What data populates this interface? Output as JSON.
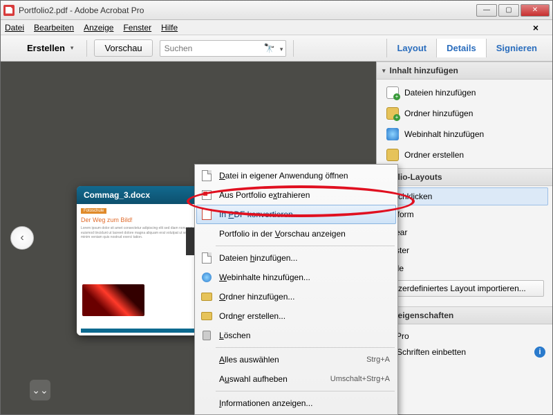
{
  "window": {
    "title": "Portfolio2.pdf - Adobe Acrobat Pro"
  },
  "menubar": {
    "items": [
      "Datei",
      "Bearbeiten",
      "Anzeige",
      "Fenster",
      "Hilfe"
    ]
  },
  "toolbar": {
    "create_label": "Erstellen",
    "preview_label": "Vorschau",
    "search_placeholder": "Suchen",
    "tabs": {
      "layout": "Layout",
      "details": "Details",
      "sign": "Signieren"
    },
    "active_tab": "details"
  },
  "stage": {
    "doc_filename": "Commag_3.docx",
    "thumb": {
      "tag": "Fotoschule",
      "heading": "Der Weg zum Bild!"
    }
  },
  "panel": {
    "add_header": "Inhalt hinzufügen",
    "add_items": [
      {
        "icon": "file-add-icon",
        "label": "Dateien hinzufügen"
      },
      {
        "icon": "folder-add-icon",
        "label": "Ordner hinzufügen"
      },
      {
        "icon": "globe-add-icon",
        "label": "Webinhalt hinzufügen"
      },
      {
        "icon": "folder-new-icon",
        "label": "Ordner erstellen"
      }
    ],
    "layouts_header_suffix": "lio-Layouts",
    "layouts": [
      {
        "label_suffix": "rchklicken",
        "selected": true
      },
      {
        "label_suffix": "iform"
      },
      {
        "label_suffix": "ear"
      },
      {
        "label_suffix": "ster"
      },
      {
        "label_suffix": "lle"
      }
    ],
    "layout_import_suffix": "zerdefiniertes Layout importieren...",
    "props_header_suffix": "eigenschaften",
    "props_value_suffix": "Pro",
    "embed_fonts_label": "Schriften einbetten"
  },
  "context_menu": {
    "items": [
      {
        "icon": "document-icon",
        "label": "Datei in eigener Anwendung öffnen",
        "u": "D"
      },
      {
        "icon": "portfolio-remove-icon",
        "label": "Aus Portfolio extrahieren",
        "u": "x"
      },
      {
        "icon": "pdf-icon",
        "label": "In PDF konvertieren...",
        "u": "P",
        "highlight": true
      },
      {
        "icon": "",
        "label": "Portfolio in der Vorschau anzeigen",
        "u": "V"
      },
      {
        "sep": true
      },
      {
        "icon": "file-add-icon",
        "label": "Dateien hinzufügen...",
        "u": "h"
      },
      {
        "icon": "globe-add-icon",
        "label": "Webinhalte hinzufügen...",
        "u": "W"
      },
      {
        "icon": "folder-add-icon",
        "label": "Ordner hinzufügen...",
        "u": "O"
      },
      {
        "icon": "folder-new-icon",
        "label": "Ordner erstellen...",
        "u": "e"
      },
      {
        "icon": "trash-icon",
        "label": "Löschen",
        "u": "L"
      },
      {
        "sep": true
      },
      {
        "icon": "",
        "label": "Alles auswählen",
        "u": "A",
        "shortcut": "Strg+A"
      },
      {
        "icon": "",
        "label": "Auswahl aufheben",
        "u": "u",
        "shortcut": "Umschalt+Strg+A"
      },
      {
        "sep": true
      },
      {
        "icon": "",
        "label": "Informationen anzeigen...",
        "u": "I"
      }
    ]
  },
  "annotation": {
    "highlight_target": "In PDF konvertieren..."
  }
}
